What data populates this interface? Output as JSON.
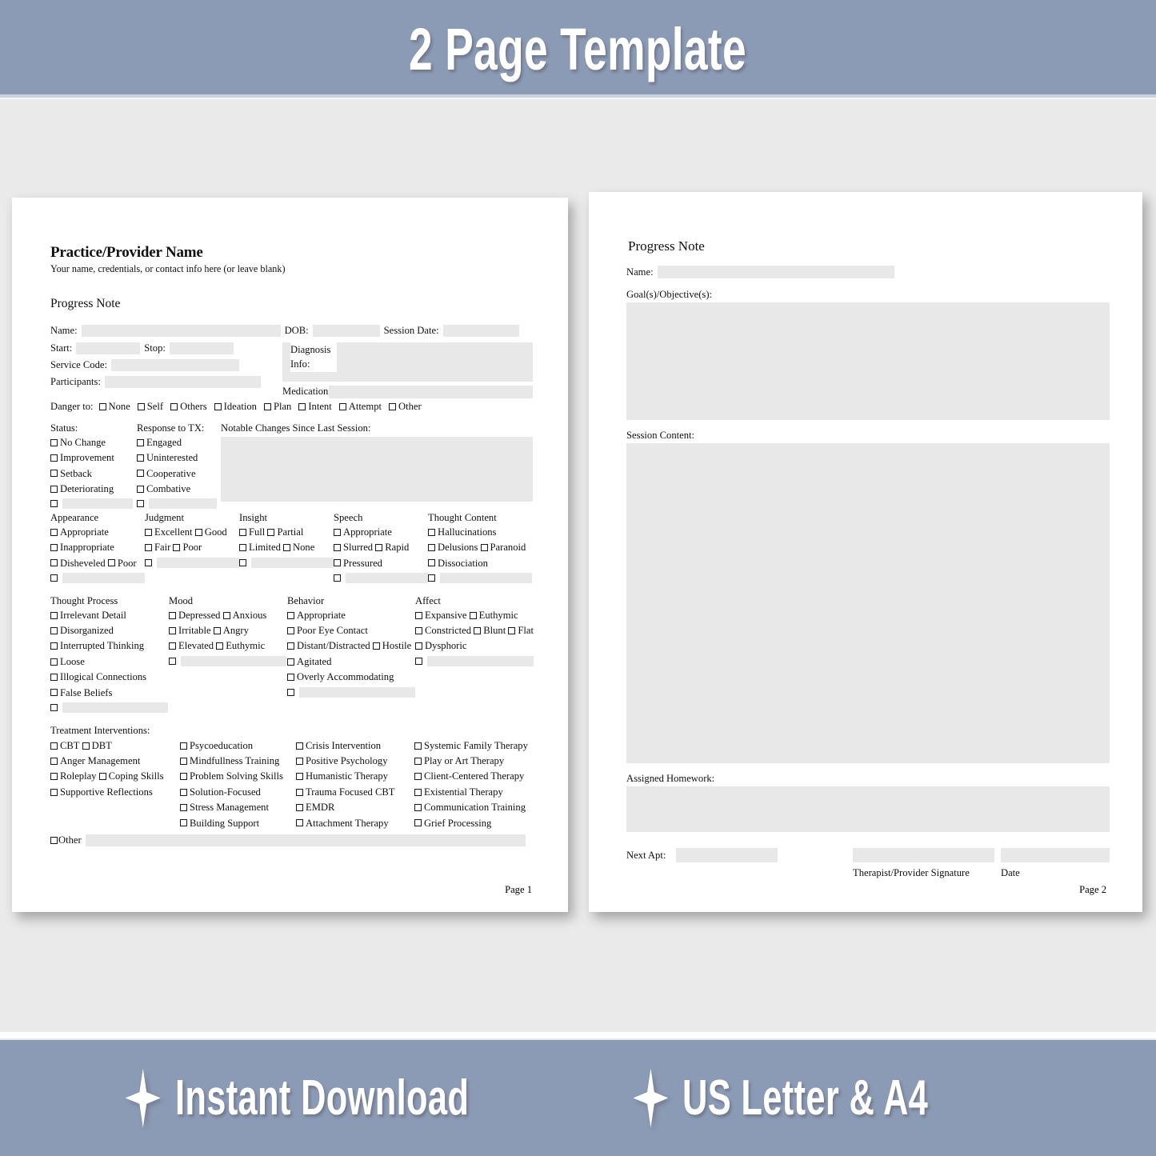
{
  "top_banner": {
    "text": "2 Page Template"
  },
  "bottom_banner": {
    "items": [
      {
        "icon": "sparkle-icon",
        "label": "Instant Download"
      },
      {
        "icon": "sparkle-icon",
        "label": "US Letter & A4"
      }
    ]
  },
  "colors": {
    "banner_background": "#8b9ab5",
    "banner_text": "#ffffff",
    "page_background": "#eaeaea",
    "paper": "#ffffff",
    "field_fill": "#e8e8e8",
    "ink": "#101010"
  },
  "page1": {
    "practice_title": "Practice/Provider Name",
    "practice_subtitle": "Your name, credentials, or contact info here (or leave blank)",
    "document_title": "Progress Note",
    "identity": {
      "name_label": "Name:",
      "dob_label": "DOB:",
      "session_date_label": "Session Date:"
    },
    "timing": {
      "start_label": "Start:",
      "stop_label": "Stop:",
      "service_code_label": "Service Code:",
      "participants_label": "Participants:",
      "diagnosis_info_label": "Diagnosis Info:",
      "medications_label": "Medications:"
    },
    "danger": {
      "label": "Danger to:",
      "options": [
        "None",
        "Self",
        "Others",
        "Ideation",
        "Plan",
        "Intent",
        "Attempt",
        "Other"
      ]
    },
    "status": {
      "heading": "Status:",
      "options": [
        "No Change",
        "Improvement",
        "Setback",
        "Deteriorating"
      ]
    },
    "response_to_tx": {
      "heading": "Response to TX:",
      "options": [
        "Engaged",
        "Uninterested",
        "Cooperative",
        "Combative"
      ]
    },
    "notable_changes": {
      "heading": "Notable Changes Since Last Session:"
    },
    "mse_row_1": [
      {
        "heading": "Appearance",
        "options": [
          "Appropriate",
          "Inappropriate",
          "Disheveled",
          "Poor"
        ]
      },
      {
        "heading": "Judgment",
        "options": [
          "Excellent",
          "Good",
          "Fair",
          "Poor"
        ]
      },
      {
        "heading": "Insight",
        "options": [
          "Full",
          "Partial",
          "Limited",
          "None"
        ]
      },
      {
        "heading": "Speech",
        "options": [
          "Appropriate",
          "Slurred",
          "Rapid",
          "Pressured"
        ]
      },
      {
        "heading": "Thought Content",
        "options": [
          "Hallucinations",
          "Delusions",
          "Paranoid",
          "Dissociation"
        ]
      }
    ],
    "mse_row_2": [
      {
        "heading": "Thought Process",
        "options": [
          "Irrelevant Detail",
          "Disorganized",
          "Interrupted Thinking",
          "Loose",
          "Illogical Connections",
          "False Beliefs"
        ]
      },
      {
        "heading": "Mood",
        "options": [
          "Depressed",
          "Anxious",
          "Irritable",
          "Angry",
          "Elevated",
          "Euthymic"
        ]
      },
      {
        "heading": "Behavior",
        "options": [
          "Appropriate",
          "Poor Eye Contact",
          "Distant/Distracted",
          "Hostile",
          "Agitated",
          "Overly Accommodating"
        ]
      },
      {
        "heading": "Affect",
        "options": [
          "Expansive",
          "Euthymic",
          "Constricted",
          "Blunt",
          "Flat",
          "Dysphoric"
        ]
      }
    ],
    "treatment": {
      "heading": "Treatment Interventions:",
      "columns": [
        [
          "CBT",
          "DBT",
          "Anger Management",
          "Roleplay",
          "Coping Skills",
          "Supportive Reflections"
        ],
        [
          "Psycoeducation",
          "Mindfullness Training",
          "Problem Solving Skills",
          "Solution-Focused",
          "Stress Management",
          "Building Support"
        ],
        [
          "Crisis Intervention",
          "Positive Psychology",
          "Humanistic Therapy",
          "Trauma Focused CBT",
          "EMDR",
          "Attachment Therapy"
        ],
        [
          "Systemic Family Therapy",
          "Play or Art Therapy",
          "Client-Centered Therapy",
          "Existential Therapy",
          "Communication Training",
          "Grief Processing"
        ]
      ],
      "other_label": "Other"
    },
    "page_number": "Page 1"
  },
  "page2": {
    "document_title": "Progress Note",
    "name_label": "Name:",
    "goals_label": "Goal(s)/Objective(s):",
    "session_content_label": "Session Content:",
    "homework_label": "Assigned Homework:",
    "next_apt_label": "Next Apt:",
    "signature_caption": "Therapist/Provider Signature",
    "date_caption": "Date",
    "page_number": "Page 2"
  }
}
